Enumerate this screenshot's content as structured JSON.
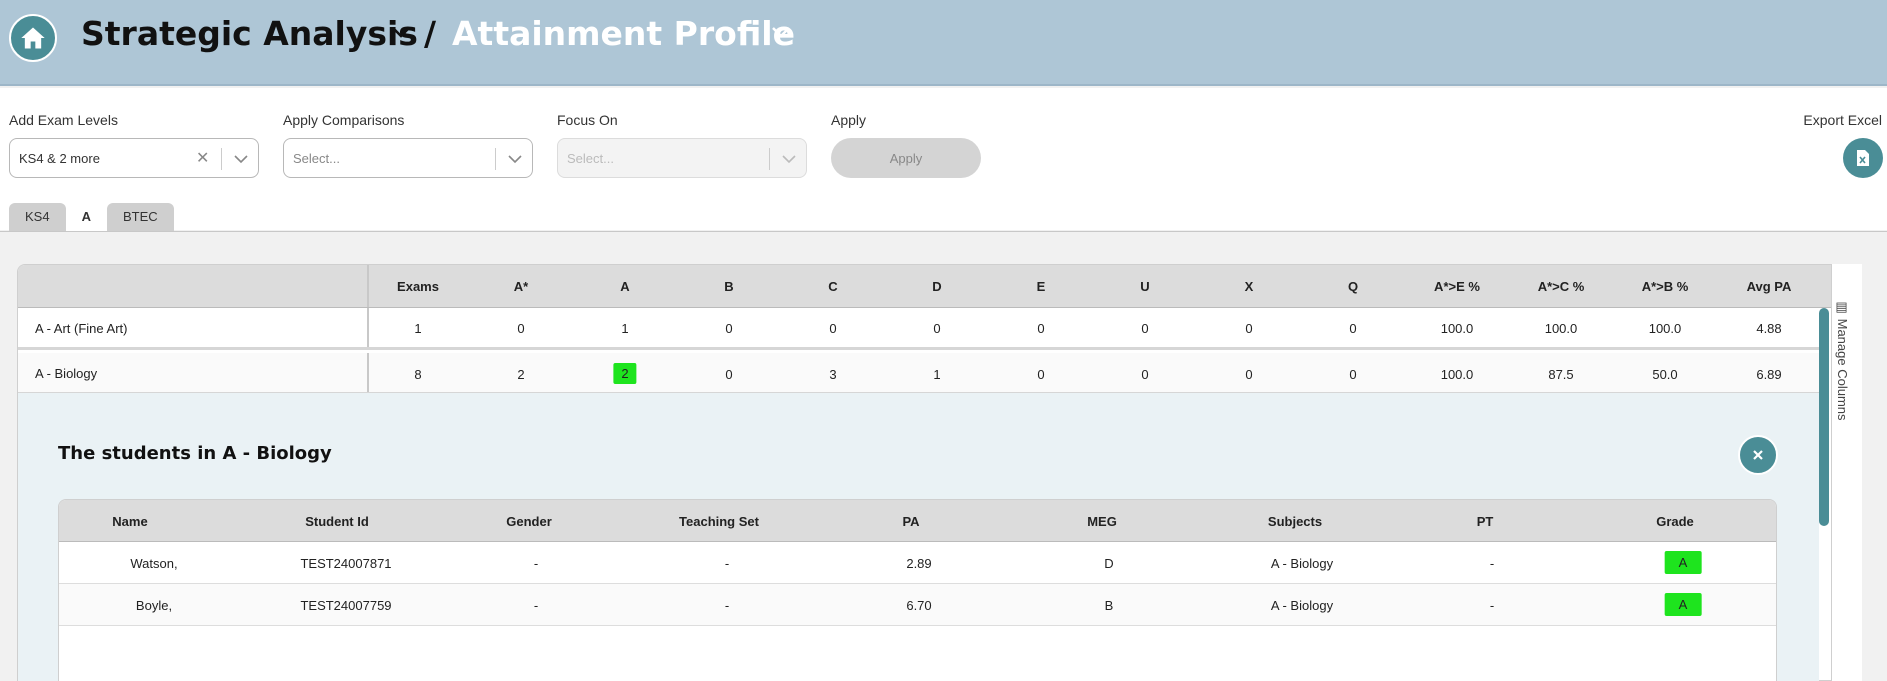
{
  "header": {
    "title": "Strategic Analysis",
    "separator": "/",
    "subtitle": "Attainment Profile"
  },
  "filters": {
    "exam_levels": {
      "label": "Add Exam Levels",
      "value": "KS4 & 2 more"
    },
    "comparisons": {
      "label": "Apply Comparisons",
      "placeholder": "Select..."
    },
    "focus_on": {
      "label": "Focus On",
      "placeholder": "Select..."
    },
    "apply": {
      "label": "Apply",
      "button": "Apply"
    },
    "export": {
      "label": "Export Excel"
    }
  },
  "tabs": [
    "KS4",
    "A",
    "BTEC"
  ],
  "active_tab": "A",
  "main_table": {
    "columns": [
      "Exams",
      "A*",
      "A",
      "B",
      "C",
      "D",
      "E",
      "U",
      "X",
      "Q",
      "A*>E %",
      "A*>C %",
      "A*>B %",
      "Avg PA"
    ],
    "rows": [
      {
        "name": "A - Art (Fine Art)",
        "values": [
          "1",
          "0",
          "1",
          "0",
          "0",
          "0",
          "0",
          "0",
          "0",
          "0",
          "100.0",
          "100.0",
          "100.0",
          "4.88"
        ]
      },
      {
        "name": "A - Biology",
        "values": [
          "8",
          "2",
          "2",
          "0",
          "3",
          "1",
          "0",
          "0",
          "0",
          "0",
          "100.0",
          "87.5",
          "50.0",
          "6.89"
        ]
      }
    ],
    "highlight_color": "#1ee41e"
  },
  "side": {
    "manage_columns": "Manage Columns"
  },
  "drilldown": {
    "title": "The students in A - Biology",
    "columns": [
      "Name",
      "Student Id",
      "Gender",
      "Teaching Set",
      "PA",
      "MEG",
      "Subjects",
      "PT",
      "Grade"
    ],
    "rows": [
      {
        "values": [
          "Watson,",
          "TEST24007871",
          "-",
          "-",
          "2.89",
          "D",
          "A - Biology",
          "-",
          "A"
        ]
      },
      {
        "values": [
          "Boyle,",
          "TEST24007759",
          "-",
          "-",
          "6.70",
          "B",
          "A - Biology",
          "-",
          "A"
        ]
      }
    ]
  },
  "colors": {
    "accent": "#4a8d96",
    "header_bg": "#aec6d6"
  }
}
